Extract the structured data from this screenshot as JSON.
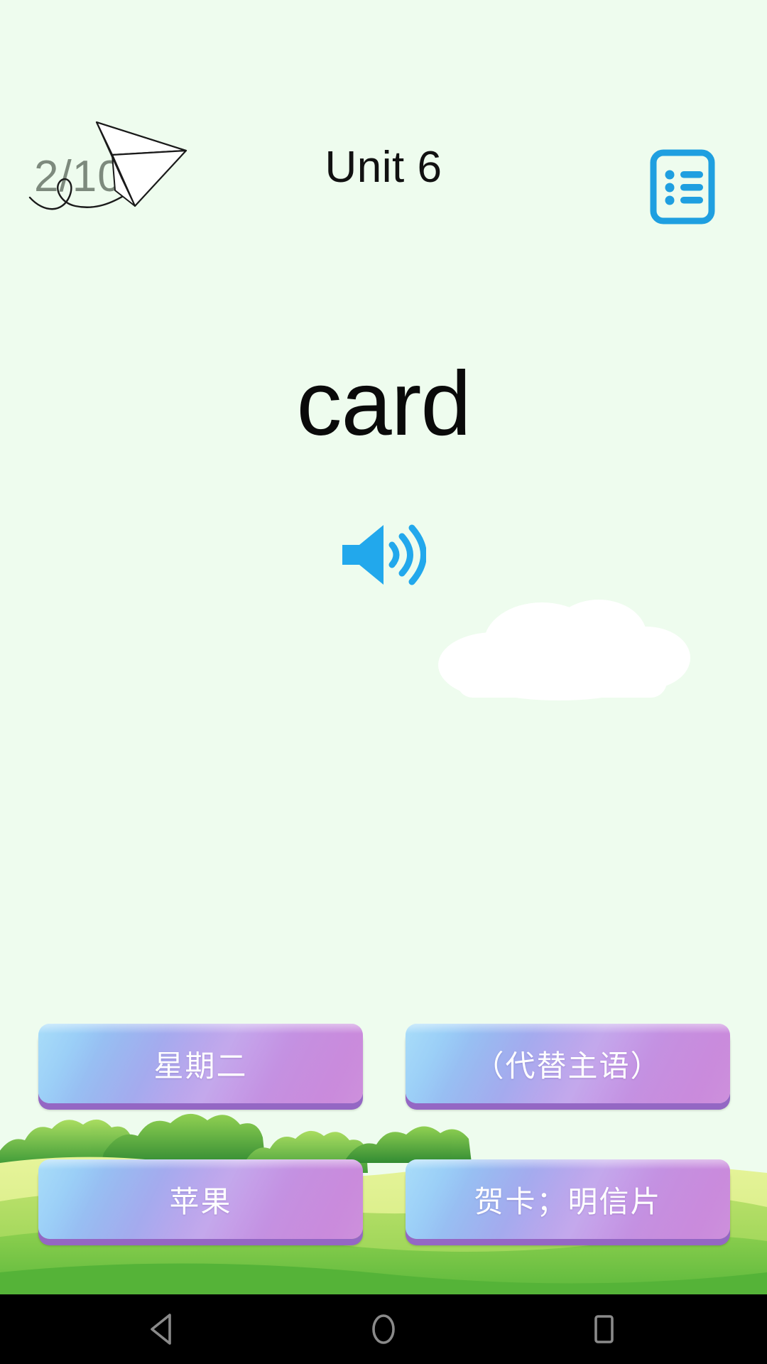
{
  "app": {
    "background_color": "#eefcee",
    "accent_blue": "#1f9fe0",
    "counter_color": "#7d8a7d"
  },
  "header": {
    "progress_counter": "2/10",
    "title": "Unit 6",
    "plane_icon": "paper-plane-icon",
    "list_icon": "list-icon"
  },
  "main": {
    "word": "card",
    "speaker_icon": "speaker-icon",
    "cloud": "cloud-decoration"
  },
  "answers": {
    "options": [
      {
        "label": "星期二"
      },
      {
        "label": "（代替主语）"
      },
      {
        "label": "苹果"
      },
      {
        "label": "贺卡；明信片"
      }
    ]
  },
  "navbar": {
    "back": "back-triangle-icon",
    "home": "home-circle-icon",
    "recents": "recents-square-icon"
  }
}
